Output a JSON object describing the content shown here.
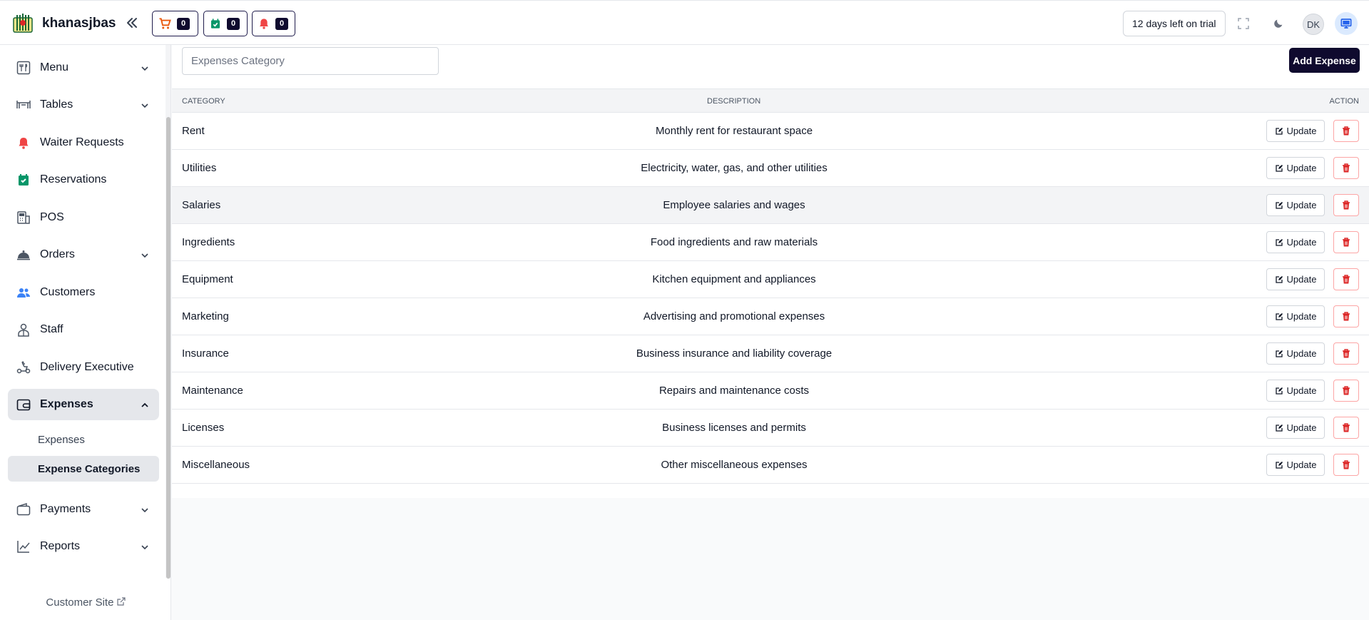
{
  "header": {
    "brand": "khanasjbas",
    "cart_count": "0",
    "reservation_count": "0",
    "waiter_count": "0",
    "trial_text": "12 days left on trial",
    "avatar_initials": "DK"
  },
  "colors": {
    "primary": "#0f0a2e",
    "cart": "#ea580c",
    "reservation": "#059669",
    "bell": "#ef4444",
    "delete": "#dc2626",
    "customers": "#3b82f6"
  },
  "sidebar": {
    "items": [
      {
        "label": "Menu",
        "icon": "menu-icon"
      },
      {
        "label": "Tables",
        "icon": "table-icon"
      },
      {
        "label": "Waiter Requests",
        "icon": "bell-icon"
      },
      {
        "label": "Reservations",
        "icon": "calendar-check-icon"
      },
      {
        "label": "POS",
        "icon": "pos-icon"
      },
      {
        "label": "Orders",
        "icon": "cloche-icon"
      },
      {
        "label": "Customers",
        "icon": "users-icon"
      },
      {
        "label": "Staff",
        "icon": "staff-icon"
      },
      {
        "label": "Delivery Executive",
        "icon": "scooter-icon"
      },
      {
        "label": "Expenses",
        "icon": "wallet-icon"
      },
      {
        "label": "Payments",
        "icon": "wallet-icon"
      },
      {
        "label": "Reports",
        "icon": "chart-icon"
      }
    ],
    "sub_items": [
      "Expenses",
      "Expense Categories"
    ],
    "customer_site": "Customer Site"
  },
  "main": {
    "search_placeholder": "Expenses Category",
    "add_button": "Add Expense",
    "columns": [
      "CATEGORY",
      "DESCRIPTION",
      "ACTION"
    ],
    "update_label": "Update",
    "rows": [
      {
        "category": "Rent",
        "description": "Monthly rent for restaurant space"
      },
      {
        "category": "Utilities",
        "description": "Electricity, water, gas, and other utilities"
      },
      {
        "category": "Salaries",
        "description": "Employee salaries and wages"
      },
      {
        "category": "Ingredients",
        "description": "Food ingredients and raw materials"
      },
      {
        "category": "Equipment",
        "description": "Kitchen equipment and appliances"
      },
      {
        "category": "Marketing",
        "description": "Advertising and promotional expenses"
      },
      {
        "category": "Insurance",
        "description": "Business insurance and liability coverage"
      },
      {
        "category": "Maintenance",
        "description": "Repairs and maintenance costs"
      },
      {
        "category": "Licenses",
        "description": "Business licenses and permits"
      },
      {
        "category": "Miscellaneous",
        "description": "Other miscellaneous expenses"
      }
    ]
  }
}
